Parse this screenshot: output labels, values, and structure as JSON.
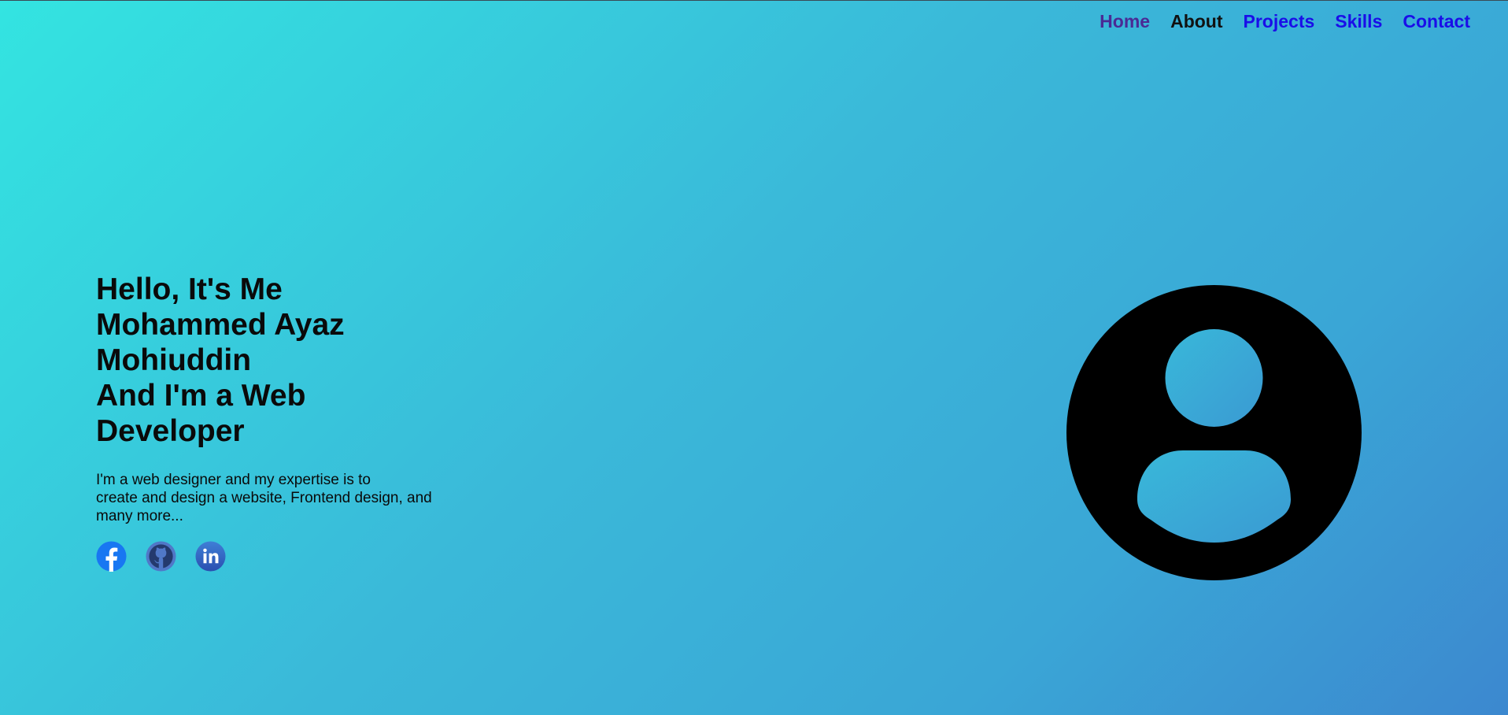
{
  "nav": {
    "items": [
      {
        "label": "Home"
      },
      {
        "label": "About"
      },
      {
        "label": "Projects"
      },
      {
        "label": "Skills"
      },
      {
        "label": "Contact"
      }
    ]
  },
  "hero": {
    "greeting": "Hello, It's Me",
    "name_line1": "Mohammed Ayaz",
    "name_line2": "Mohiuddin",
    "role_line1": "And I'm a Web",
    "role_line2": "Developer",
    "description_line1": "I'm a web designer and my expertise is to",
    "description_line2": "create and design a website, Frontend design, and",
    "description_line3": "many more..."
  },
  "social": [
    {
      "icon": "facebook-icon"
    },
    {
      "icon": "github-icon"
    },
    {
      "icon": "linkedin-icon"
    }
  ],
  "avatar": {
    "icon": "user-avatar-icon"
  },
  "colors": {
    "nav_active": "#4a2a95",
    "nav_current": "#111111",
    "nav_link": "#1a0ee8",
    "gradient_start": "#33e4e1",
    "gradient_end": "#3c88cf"
  }
}
